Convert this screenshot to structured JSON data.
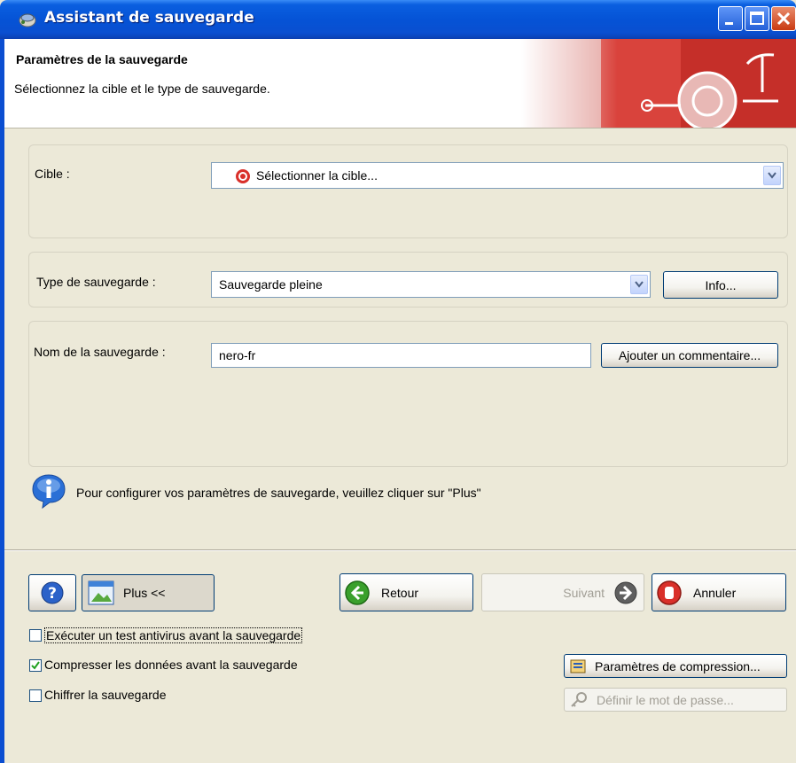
{
  "window": {
    "title": "Assistant de sauvegarde"
  },
  "header": {
    "title": "Paramètres de la sauvegarde",
    "subtitle": "Sélectionnez la cible et le type de sauvegarde."
  },
  "target": {
    "label": "Cible :",
    "value": "Sélectionner la cible..."
  },
  "backup_type": {
    "label": "Type de sauvegarde :",
    "value": "Sauvegarde pleine",
    "info_button": "Info..."
  },
  "backup_name": {
    "label": "Nom de la sauvegarde :",
    "value": "nero-fr",
    "comment_button": "Ajouter un commentaire..."
  },
  "info_message": "Pour configurer vos paramètres de sauvegarde, veuillez cliquer sur \"Plus\"",
  "nav": {
    "more_button": "Plus <<",
    "back_button": "Retour",
    "next_button": "Suivant",
    "cancel_button": "Annuler"
  },
  "options": [
    {
      "label": "Exécuter un test antivirus avant la sauvegarde",
      "checked": false
    },
    {
      "label": "Compresser les données avant la sauvegarde",
      "checked": true
    },
    {
      "label": "Chiffrer la sauvegarde",
      "checked": false
    }
  ],
  "compression_button": "Paramètres de compression...",
  "password_button": "Définir le mot de passe...",
  "colors": {
    "title_bar": "#0553d6",
    "dialog_bg": "#ece9d8",
    "accent_red": "#d9302a"
  }
}
